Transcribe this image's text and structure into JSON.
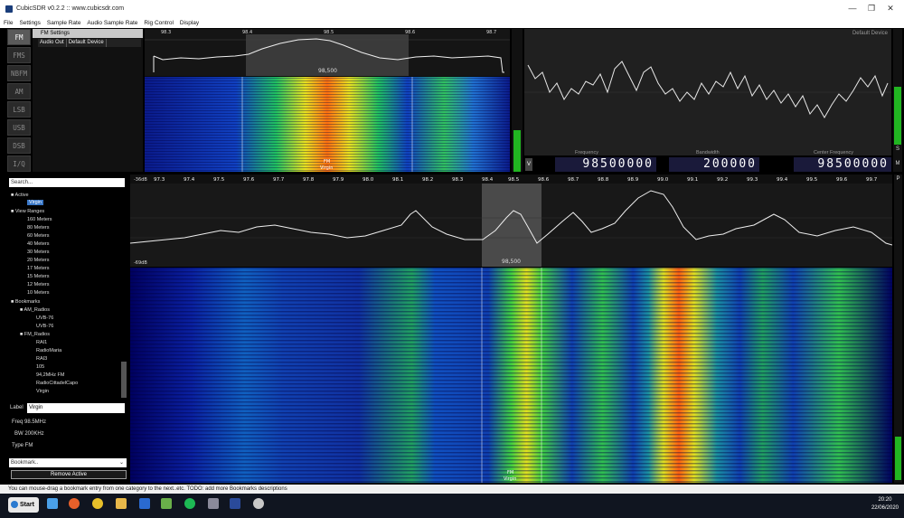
{
  "window": {
    "title": "CubicSDR v0.2.2 :: www.cubicsdr.com",
    "controls": [
      "minimize-icon",
      "maximize-icon",
      "close-icon"
    ]
  },
  "menu": [
    "File",
    "Settings",
    "Sample Rate",
    "Audio Sample Rate",
    "Rig Control",
    "Display"
  ],
  "modes": [
    {
      "label": "FM",
      "active": true
    },
    {
      "label": "FMS",
      "active": false
    },
    {
      "label": "NBFM",
      "active": false
    },
    {
      "label": "AM",
      "active": false
    },
    {
      "label": "LSB",
      "active": false
    },
    {
      "label": "USB",
      "active": false
    },
    {
      "label": "DSB",
      "active": false
    },
    {
      "label": "I/Q",
      "active": false
    }
  ],
  "fm_settings": {
    "header": "FM Settings",
    "audio_out_label": "Audio Out",
    "audio_out_value": "Default Device"
  },
  "demod_spectrum": {
    "ticks": [
      "98.3",
      "98.4",
      "98.5",
      "98.6",
      "98.7"
    ],
    "center_label": "98,500",
    "wf_label_mode": "FM",
    "wf_label_name": "Virgin"
  },
  "scope": {
    "device": "Default Device"
  },
  "digits": {
    "freq_label": "Frequency",
    "freq_value": "98500000",
    "bw_label": "Bandwidth",
    "bw_value": "200000",
    "center_label": "Center Frequency",
    "center_value": "98500000",
    "v_label": "V",
    "s_label": "S",
    "m_label": "M",
    "p_label": "P"
  },
  "tree": {
    "search_placeholder": "Search...",
    "active_header": "Active",
    "active_items": [
      "Virgin"
    ],
    "view_ranges_header": "View Ranges",
    "view_ranges": [
      "160 Meters",
      "80 Meters",
      "60 Meters",
      "40 Meters",
      "30 Meters",
      "20 Meters",
      "17 Meters",
      "15 Meters",
      "12 Meters",
      "10 Meters"
    ],
    "bookmarks_header": "Bookmarks",
    "am_folder": "AM_Radios",
    "am_items": [
      "UVB-76",
      "UVB-76"
    ],
    "fm_folder": "FM_Radios",
    "fm_items": [
      "RAI1",
      "RadioMaria",
      "RAI3",
      "105",
      "94,2MHz FM",
      "RadioCittadelCapo",
      "Virgin"
    ]
  },
  "details": {
    "label_key": "Label",
    "label_value": "Virgin",
    "freq": "Freq 98.5MHz",
    "bw": "BW 200KHz",
    "type": "Type FM",
    "bookmark_select": "Bookmark..",
    "remove_button": "Remove Active"
  },
  "main_spectrum": {
    "ticks": [
      "97.3",
      "97.4",
      "97.5",
      "97.6",
      "97.7",
      "97.8",
      "97.9",
      "98.0",
      "98.1",
      "98.2",
      "98.3",
      "98.4",
      "98.5",
      "98.6",
      "98.7",
      "98.8",
      "98.9",
      "99.0",
      "99.1",
      "99.2",
      "99.3",
      "99.4",
      "99.5",
      "99.6",
      "99.7"
    ],
    "left_top_label": "-36dB",
    "left_bottom_label": "-69dB",
    "center_label": "98,500",
    "wf_label_mode": "FM",
    "wf_label_name": "Virgin"
  },
  "status_text": "You can mouse-drag a bookmark entry from one category to the next..etc. TODO: add more Bookmarks descriptions",
  "taskbar": {
    "start_label": "Start",
    "time": "20:20",
    "date": "22/06/2020",
    "icons": [
      "task-view-icon",
      "firefox-icon",
      "chrome-icon",
      "file-explorer-icon",
      "email-icon",
      "photos-icon",
      "spotify-icon",
      "app-icon",
      "cubicsdr-icon",
      "settings-icon"
    ]
  },
  "colors": {
    "accent": "#3a78c8",
    "digit_bg": "#1a1a3a",
    "wf_cold": "#000052",
    "wf_hot": "#ff5000"
  }
}
